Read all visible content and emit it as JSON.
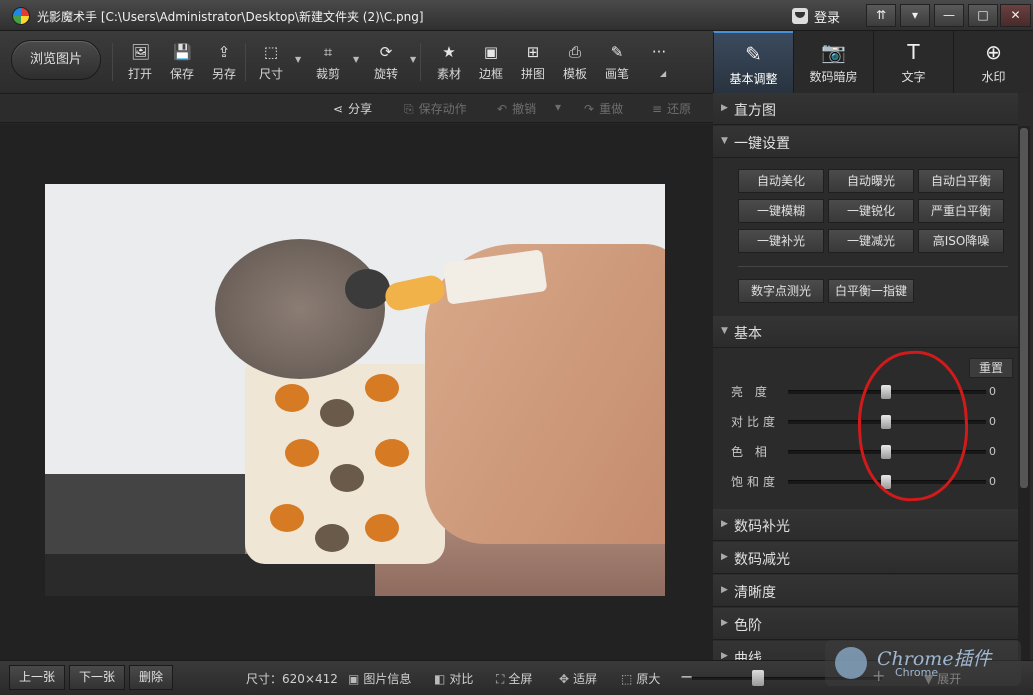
{
  "window": {
    "title": "光影魔术手  [C:\\Users\\Administrator\\Desktop\\新建文件夹 (2)\\C.png]",
    "login": "登录",
    "buttons": [
      "⇈",
      "▾",
      "—",
      "□",
      "✕"
    ]
  },
  "toolbar": {
    "browse": "浏览图片",
    "tools": [
      {
        "label": "打开",
        "icon": "open-image-icon",
        "glyph": "🖼"
      },
      {
        "label": "保存",
        "icon": "save-icon",
        "glyph": "💾"
      },
      {
        "label": "另存",
        "icon": "save-as-icon",
        "glyph": "⇪"
      },
      {
        "label": "尺寸",
        "icon": "resize-icon",
        "glyph": "⬚"
      },
      {
        "label": "裁剪",
        "icon": "crop-icon",
        "glyph": "⌗"
      },
      {
        "label": "旋转",
        "icon": "rotate-icon",
        "glyph": "⟳"
      },
      {
        "label": "素材",
        "icon": "material-icon",
        "glyph": "★"
      },
      {
        "label": "边框",
        "icon": "frame-icon",
        "glyph": "▣"
      },
      {
        "label": "拼图",
        "icon": "collage-icon",
        "glyph": "⊞"
      },
      {
        "label": "模板",
        "icon": "template-icon",
        "glyph": "⎙"
      },
      {
        "label": "画笔",
        "icon": "brush-icon",
        "glyph": "✎"
      },
      {
        "label": "",
        "icon": "more-icon",
        "glyph": "···"
      }
    ]
  },
  "tabs": [
    {
      "label": "基本调整",
      "icon": "basic-adjust-icon",
      "glyph": "✎",
      "active": true
    },
    {
      "label": "数码暗房",
      "icon": "darkroom-icon",
      "glyph": "📷",
      "active": false
    },
    {
      "label": "文字",
      "icon": "text-icon",
      "glyph": "T",
      "active": false
    },
    {
      "label": "水印",
      "icon": "watermark-icon",
      "glyph": "⊕",
      "active": false
    }
  ],
  "actions": {
    "share": "分享",
    "save_action": "保存动作",
    "undo": "撤销",
    "redo": "重做",
    "restore": "还原"
  },
  "panel": {
    "histogram": "直方图",
    "one_click": {
      "title": "一键设置",
      "buttons": [
        "自动美化",
        "自动曝光",
        "自动白平衡",
        "一键模糊",
        "一键锐化",
        "严重白平衡",
        "一键补光",
        "一键减光",
        "高ISO降噪"
      ],
      "extra": [
        "数字点测光",
        "白平衡一指键"
      ]
    },
    "basic": {
      "title": "基本",
      "reset": "重置",
      "sliders": [
        {
          "label": "亮  度",
          "value": "0"
        },
        {
          "label": "对比度",
          "value": "0"
        },
        {
          "label": "色  相",
          "value": "0"
        },
        {
          "label": "饱和度",
          "value": "0"
        }
      ]
    },
    "more_sections": [
      "数码补光",
      "数码减光",
      "清晰度",
      "色阶",
      "曲线"
    ]
  },
  "bottom": {
    "prev": "上一张",
    "next": "下一张",
    "delete": "删除",
    "size_label": "尺寸：620×412",
    "image_info": "图片信息",
    "compare": "对比",
    "fullscreen": "全屏",
    "fit": "适屏",
    "original": "原大",
    "expand": "展开"
  },
  "watermark": {
    "line1": "Chrome插件",
    "line2": "Chrome"
  },
  "colors": {
    "accent": "#4a90d9",
    "annotation": "#d11a1a"
  }
}
